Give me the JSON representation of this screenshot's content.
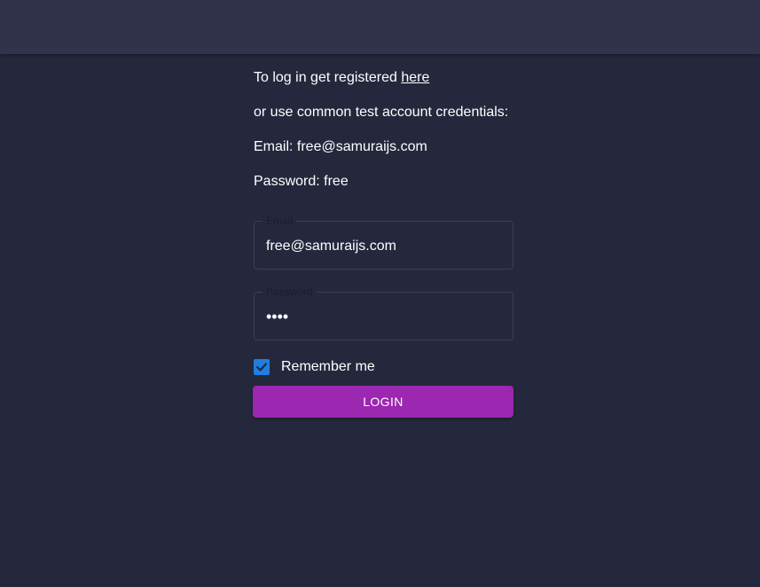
{
  "intro": {
    "register_prefix": "To log in get registered ",
    "register_link": "here",
    "common_credentials": "or use common test account credentials:",
    "email_line": "Email: free@samuraijs.com",
    "password_line": "Password: free"
  },
  "form": {
    "email": {
      "label": "Email",
      "value": "free@samuraijs.com"
    },
    "password": {
      "label": "Password",
      "value": "••••"
    },
    "remember_me": {
      "label": "Remember me",
      "checked": true
    },
    "login_button": "LOGIN"
  },
  "colors": {
    "background": "#25283d",
    "topbar": "#30334b",
    "checkbox": "#1e7fe0",
    "button": "#9c27b0"
  }
}
